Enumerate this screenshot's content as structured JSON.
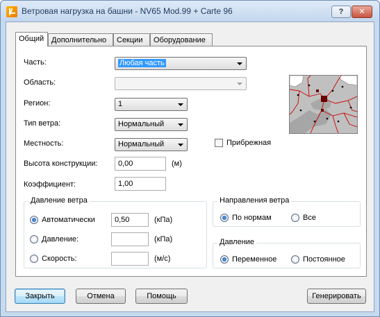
{
  "window": {
    "title": "Ветровая нагрузка на башни - NV65 Mod.99 + Carte 96",
    "help_label": "?",
    "close_label": "✕"
  },
  "tabs": [
    {
      "label": "Общий",
      "active": true
    },
    {
      "label": "Дополнительно",
      "active": false
    },
    {
      "label": "Секции",
      "active": false
    },
    {
      "label": "Оборудование",
      "active": false
    }
  ],
  "form": {
    "part": {
      "label": "Часть:",
      "value": "Любая часть"
    },
    "area": {
      "label": "Область:",
      "value": ""
    },
    "region": {
      "label": "Регион:",
      "value": "1"
    },
    "wind_type": {
      "label": "Тип ветра:",
      "value": "Нормальный"
    },
    "terrain": {
      "label": "Местность:",
      "value": "Нормальный"
    },
    "coastal": {
      "label": "Прибрежная",
      "checked": false
    },
    "height": {
      "label": "Высота конструкции:",
      "value": "0,00",
      "unit": "(м)"
    },
    "coefficient": {
      "label": "Коэффициент:",
      "value": "1,00"
    }
  },
  "wind_pressure": {
    "title": "Давление ветра",
    "options": [
      {
        "label": "Автоматически",
        "value": "0,50",
        "unit": "(кПа)",
        "checked": true
      },
      {
        "label": "Давление:",
        "value": "",
        "unit": "(кПа)",
        "checked": false
      },
      {
        "label": "Скорость:",
        "value": "",
        "unit": "(м/с)",
        "checked": false
      }
    ]
  },
  "wind_direction": {
    "title": "Направления ветра",
    "options": [
      {
        "label": "По нормам",
        "checked": true
      },
      {
        "label": "Все",
        "checked": false
      }
    ]
  },
  "pressure": {
    "title": "Давление",
    "options": [
      {
        "label": "Переменное",
        "checked": true
      },
      {
        "label": "Постоянное",
        "checked": false
      }
    ]
  },
  "buttons": {
    "close": "Закрыть",
    "cancel": "Отмена",
    "help": "Помощь",
    "generate": "Генерировать"
  },
  "colors": {
    "map_border_lines": "#cc0000",
    "map_land": "#c0c0c0",
    "default_button": "#3c7fb1"
  }
}
